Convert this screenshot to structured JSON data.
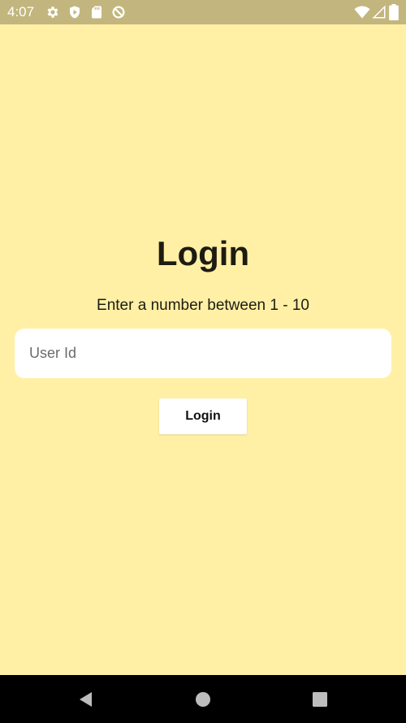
{
  "status_bar": {
    "time": "4:07",
    "background": "#C2B67E",
    "left_icons": [
      "gear-icon",
      "shield-play-icon",
      "sd-card-icon",
      "blocked-icon"
    ],
    "right_icons": [
      "wifi-icon",
      "cell-signal-icon",
      "battery-icon"
    ]
  },
  "screen": {
    "background": "#FFF0A5",
    "title": "Login",
    "subtitle": "Enter a number between 1 - 10",
    "user_id": {
      "placeholder": "User Id",
      "value": ""
    },
    "login_button_label": "Login"
  },
  "nav_bar": {
    "icons": [
      "back-icon",
      "home-icon",
      "recents-icon"
    ]
  }
}
